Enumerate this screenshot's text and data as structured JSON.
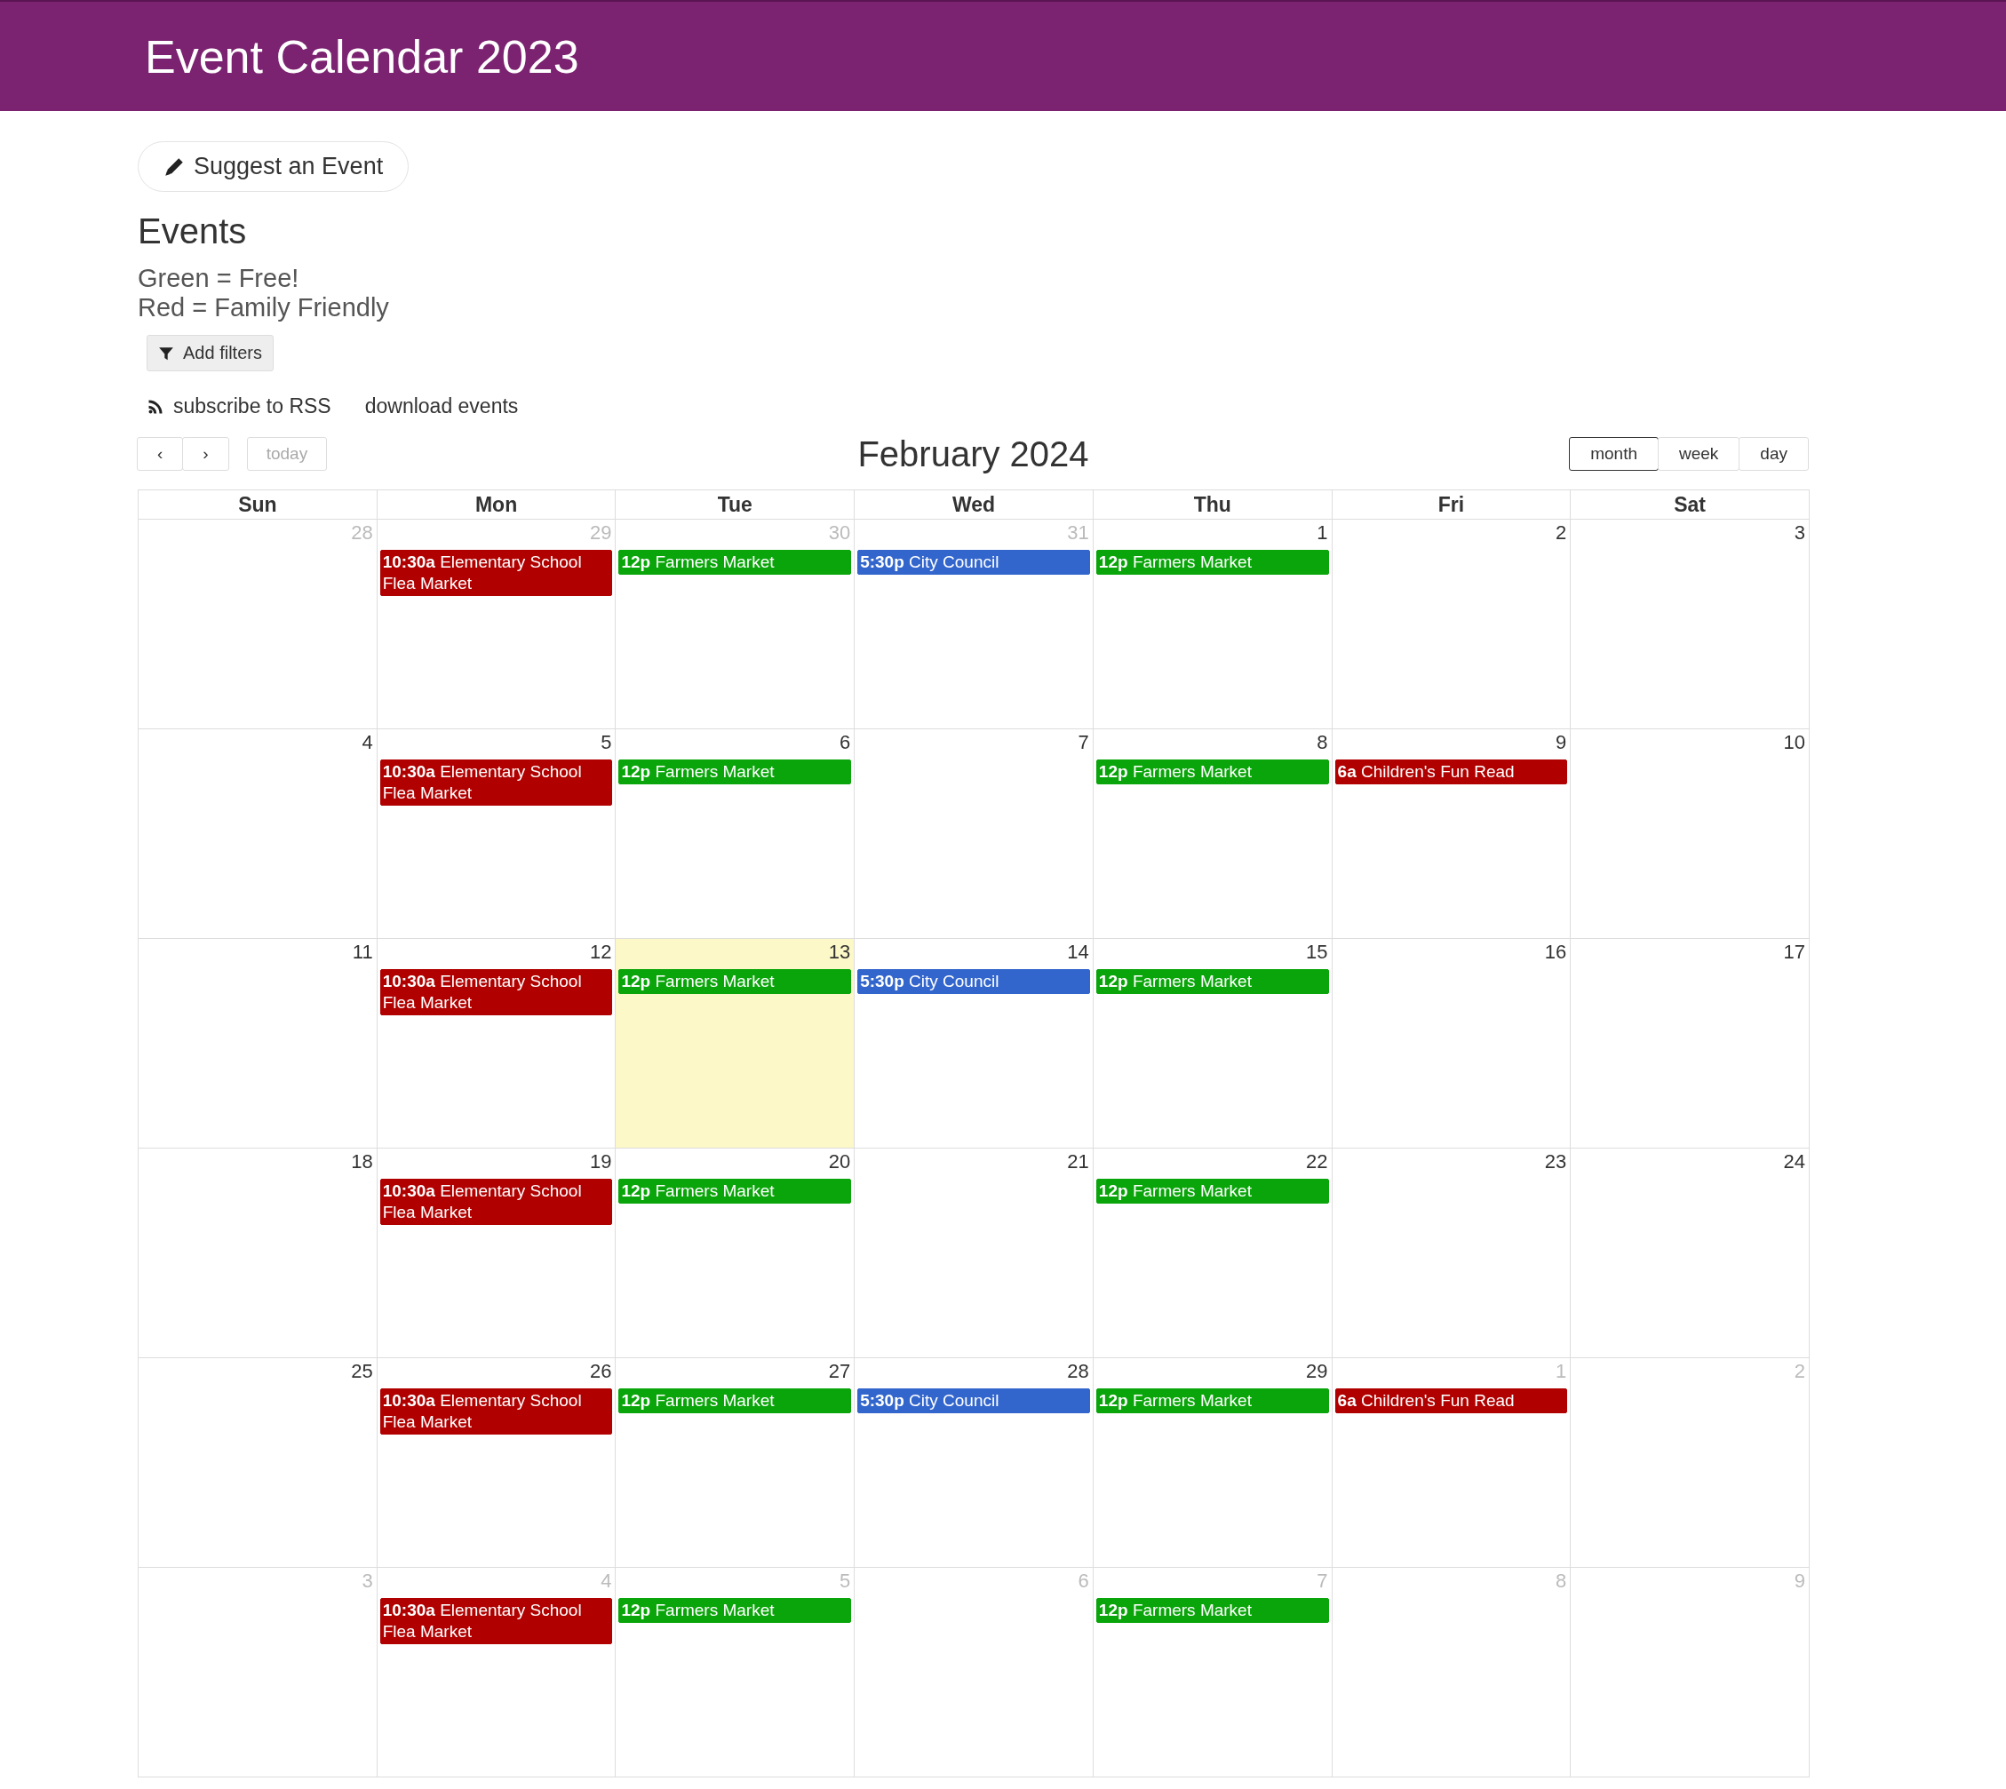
{
  "header": {
    "title": "Event Calendar 2023"
  },
  "suggest_button": {
    "label": "Suggest an Event"
  },
  "heading": "Events",
  "legend": [
    "Green = Free!",
    "Red = Family Friendly"
  ],
  "filters_button": {
    "label": "Add filters"
  },
  "links": [
    {
      "kind": "rss",
      "label": "subscribe to RSS"
    },
    {
      "kind": "plain",
      "label": "download events"
    }
  ],
  "toolbar": {
    "prev": "‹",
    "next": "›",
    "today": {
      "label": "today",
      "disabled": true
    },
    "title": "February 2024",
    "views": [
      {
        "label": "month",
        "selected": true
      },
      {
        "label": "week",
        "selected": false
      },
      {
        "label": "day",
        "selected": false
      }
    ]
  },
  "weekdays": [
    "Sun",
    "Mon",
    "Tue",
    "Wed",
    "Thu",
    "Fri",
    "Sat"
  ],
  "weeks": [
    [
      {
        "date": "28",
        "other_month": true,
        "today": false
      },
      {
        "date": "29",
        "other_month": true,
        "today": false,
        "events": [
          {
            "time": "10:30a",
            "title": "Elementary School Flea Market",
            "color": "#b00000"
          }
        ]
      },
      {
        "date": "30",
        "other_month": true,
        "today": false,
        "events": [
          {
            "time": "12p",
            "title": "Farmers Market",
            "color": "#0aa50a"
          }
        ]
      },
      {
        "date": "31",
        "other_month": true,
        "today": false,
        "events": [
          {
            "time": "5:30p",
            "title": "City Council",
            "color": "#3366cc"
          }
        ]
      },
      {
        "date": "1",
        "other_month": false,
        "today": false,
        "events": [
          {
            "time": "12p",
            "title": "Farmers Market",
            "color": "#0aa50a"
          }
        ]
      },
      {
        "date": "2",
        "other_month": false,
        "today": false
      },
      {
        "date": "3",
        "other_month": false,
        "today": false
      }
    ],
    [
      {
        "date": "4",
        "other_month": false,
        "today": false
      },
      {
        "date": "5",
        "other_month": false,
        "today": false,
        "events": [
          {
            "time": "10:30a",
            "title": "Elementary School Flea Market",
            "color": "#b00000"
          }
        ]
      },
      {
        "date": "6",
        "other_month": false,
        "today": false,
        "events": [
          {
            "time": "12p",
            "title": "Farmers Market",
            "color": "#0aa50a"
          }
        ]
      },
      {
        "date": "7",
        "other_month": false,
        "today": false
      },
      {
        "date": "8",
        "other_month": false,
        "today": false,
        "events": [
          {
            "time": "12p",
            "title": "Farmers Market",
            "color": "#0aa50a"
          }
        ]
      },
      {
        "date": "9",
        "other_month": false,
        "today": false,
        "events": [
          {
            "time": "6a",
            "title": "Children's Fun Read",
            "color": "#b00000"
          }
        ]
      },
      {
        "date": "10",
        "other_month": false,
        "today": false
      }
    ],
    [
      {
        "date": "11",
        "other_month": false,
        "today": false
      },
      {
        "date": "12",
        "other_month": false,
        "today": false,
        "events": [
          {
            "time": "10:30a",
            "title": "Elementary School Flea Market",
            "color": "#b00000"
          }
        ]
      },
      {
        "date": "13",
        "other_month": false,
        "today": true,
        "events": [
          {
            "time": "12p",
            "title": "Farmers Market",
            "color": "#0aa50a"
          }
        ]
      },
      {
        "date": "14",
        "other_month": false,
        "today": false,
        "events": [
          {
            "time": "5:30p",
            "title": "City Council",
            "color": "#3366cc"
          }
        ]
      },
      {
        "date": "15",
        "other_month": false,
        "today": false,
        "events": [
          {
            "time": "12p",
            "title": "Farmers Market",
            "color": "#0aa50a"
          }
        ]
      },
      {
        "date": "16",
        "other_month": false,
        "today": false
      },
      {
        "date": "17",
        "other_month": false,
        "today": false
      }
    ],
    [
      {
        "date": "18",
        "other_month": false,
        "today": false
      },
      {
        "date": "19",
        "other_month": false,
        "today": false,
        "events": [
          {
            "time": "10:30a",
            "title": "Elementary School Flea Market",
            "color": "#b00000"
          }
        ]
      },
      {
        "date": "20",
        "other_month": false,
        "today": false,
        "events": [
          {
            "time": "12p",
            "title": "Farmers Market",
            "color": "#0aa50a"
          }
        ]
      },
      {
        "date": "21",
        "other_month": false,
        "today": false
      },
      {
        "date": "22",
        "other_month": false,
        "today": false,
        "events": [
          {
            "time": "12p",
            "title": "Farmers Market",
            "color": "#0aa50a"
          }
        ]
      },
      {
        "date": "23",
        "other_month": false,
        "today": false
      },
      {
        "date": "24",
        "other_month": false,
        "today": false
      }
    ],
    [
      {
        "date": "25",
        "other_month": false,
        "today": false
      },
      {
        "date": "26",
        "other_month": false,
        "today": false,
        "events": [
          {
            "time": "10:30a",
            "title": "Elementary School Flea Market",
            "color": "#b00000"
          }
        ]
      },
      {
        "date": "27",
        "other_month": false,
        "today": false,
        "events": [
          {
            "time": "12p",
            "title": "Farmers Market",
            "color": "#0aa50a"
          }
        ]
      },
      {
        "date": "28",
        "other_month": false,
        "today": false,
        "events": [
          {
            "time": "5:30p",
            "title": "City Council",
            "color": "#3366cc"
          }
        ]
      },
      {
        "date": "29",
        "other_month": false,
        "today": false,
        "events": [
          {
            "time": "12p",
            "title": "Farmers Market",
            "color": "#0aa50a"
          }
        ]
      },
      {
        "date": "1",
        "other_month": true,
        "today": false,
        "events": [
          {
            "time": "6a",
            "title": "Children's Fun Read",
            "color": "#b00000"
          }
        ]
      },
      {
        "date": "2",
        "other_month": true,
        "today": false
      }
    ],
    [
      {
        "date": "3",
        "other_month": true,
        "today": false
      },
      {
        "date": "4",
        "other_month": true,
        "today": false,
        "events": [
          {
            "time": "10:30a",
            "title": "Elementary School Flea Market",
            "color": "#b00000"
          }
        ]
      },
      {
        "date": "5",
        "other_month": true,
        "today": false,
        "events": [
          {
            "time": "12p",
            "title": "Farmers Market",
            "color": "#0aa50a"
          }
        ]
      },
      {
        "date": "6",
        "other_month": true,
        "today": false
      },
      {
        "date": "7",
        "other_month": true,
        "today": false,
        "events": [
          {
            "time": "12p",
            "title": "Farmers Market",
            "color": "#0aa50a"
          }
        ]
      },
      {
        "date": "8",
        "other_month": true,
        "today": false
      },
      {
        "date": "9",
        "other_month": true,
        "today": false
      }
    ]
  ]
}
